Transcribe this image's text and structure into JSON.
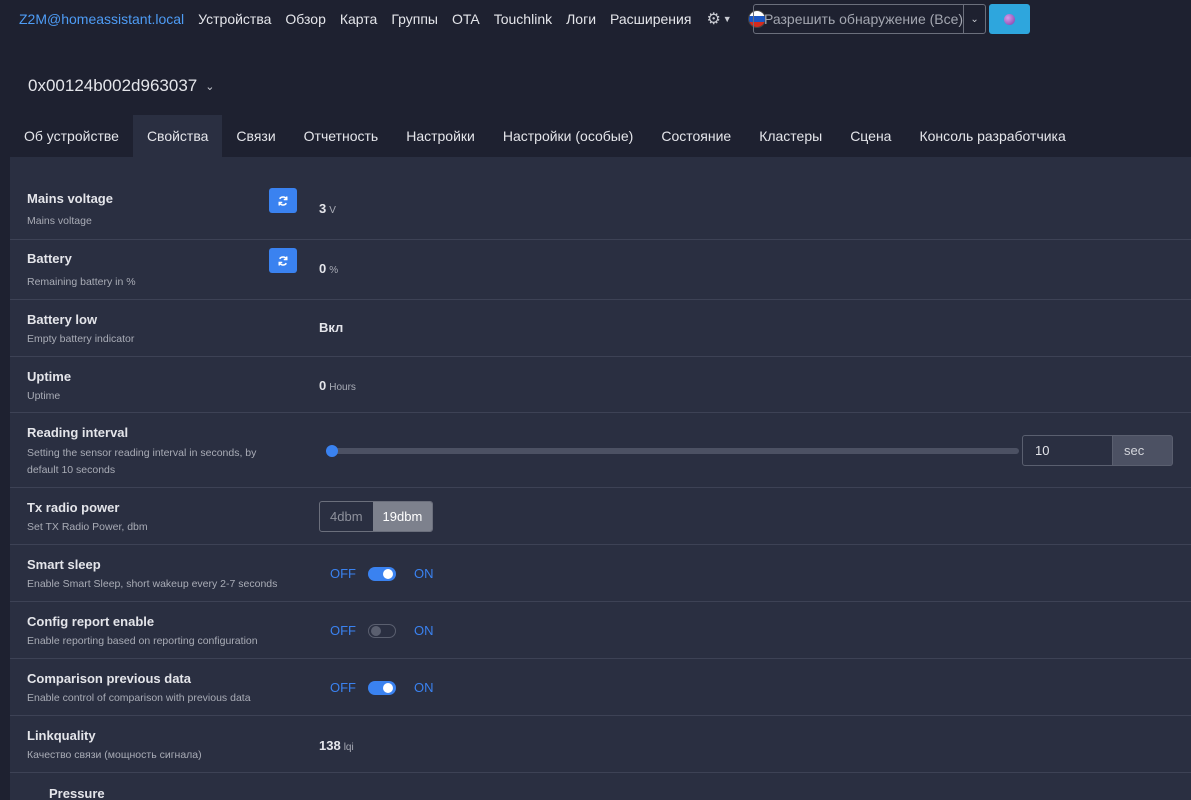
{
  "navbar": {
    "brand": "Z2M@homeassistant.local",
    "links": [
      "Устройства",
      "Обзор",
      "Карта",
      "Группы",
      "OTA",
      "Touchlink",
      "Логи",
      "Расширения"
    ],
    "settings_icon": "gear-icon",
    "language_icon": "flag-ru-icon",
    "permit_join_label": "Разрешить обнаружение (Все)",
    "permit_caret_icon": "chevron-down-icon",
    "permit_button_icon": "globe-icon"
  },
  "device": {
    "title": "0x00124b002d963037",
    "chevron_icon": "chevron-down-icon"
  },
  "tabs": [
    {
      "label": "Об устройстве",
      "active": false
    },
    {
      "label": "Свойства",
      "active": true
    },
    {
      "label": "Связи",
      "active": false
    },
    {
      "label": "Отчетность",
      "active": false
    },
    {
      "label": "Настройки",
      "active": false
    },
    {
      "label": "Настройки (особые)",
      "active": false
    },
    {
      "label": "Состояние",
      "active": false
    },
    {
      "label": "Кластеры",
      "active": false
    },
    {
      "label": "Сцена",
      "active": false
    },
    {
      "label": "Консоль разработчика",
      "active": false
    }
  ],
  "features": {
    "mains_voltage": {
      "title": "Mains voltage",
      "desc": "Mains voltage",
      "value": "3",
      "unit": "V"
    },
    "battery": {
      "title": "Battery",
      "desc": "Remaining battery in %",
      "value": "0",
      "unit": "%"
    },
    "battery_low": {
      "title": "Battery low",
      "desc": "Empty battery indicator",
      "value": "Вкл"
    },
    "uptime": {
      "title": "Uptime",
      "desc": "Uptime",
      "value": "0",
      "unit": "Hours"
    },
    "reading_interval": {
      "title": "Reading interval",
      "desc": "Setting the sensor reading interval in seconds, by default 10 seconds",
      "value": "10",
      "unit": "sec",
      "slider_fraction": 0
    },
    "tx_radio_power": {
      "title": "Tx radio power",
      "desc": "Set TX Radio Power, dbm",
      "options": [
        "4dbm",
        "19dbm"
      ],
      "selected": "19dbm"
    },
    "smart_sleep": {
      "title": "Smart sleep",
      "desc": "Enable Smart Sleep, short wakeup every 2-7 seconds",
      "off_label": "OFF",
      "on_label": "ON",
      "state": "on"
    },
    "config_report_enable": {
      "title": "Config report enable",
      "desc": "Enable reporting based on reporting configuration",
      "off_label": "OFF",
      "on_label": "ON",
      "state": "off"
    },
    "comparison_previous_data": {
      "title": "Comparison previous data",
      "desc": "Enable control of comparison with previous data",
      "off_label": "OFF",
      "on_label": "ON",
      "state": "on"
    },
    "linkquality": {
      "title": "Linkquality",
      "desc": "Качество связи (мощность сигнала)",
      "value": "138",
      "unit": "lqi"
    },
    "pressure": {
      "title": "Pressure"
    }
  },
  "colors": {
    "accent": "#3a82f0",
    "brand": "#4e9cf5",
    "background": "#1e2130",
    "panel": "#2a2f41"
  }
}
